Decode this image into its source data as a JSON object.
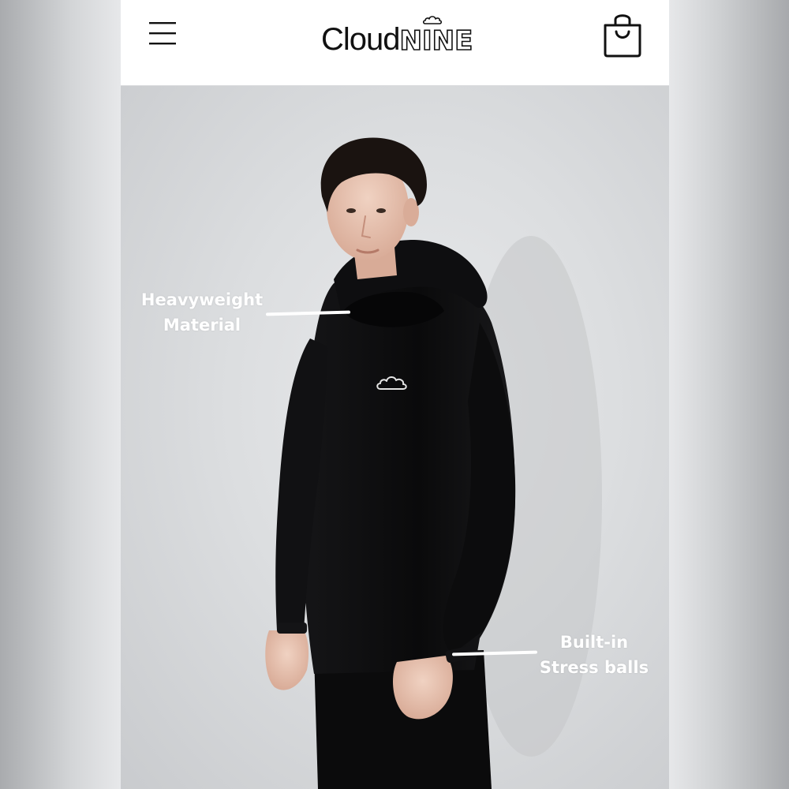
{
  "header": {
    "menu_icon": "hamburger-menu-icon",
    "brand": {
      "name_part1": "Cloud",
      "name_part2": "NINE",
      "icon": "cloud-icon"
    },
    "cart_icon": "shopping-bag-icon"
  },
  "hero": {
    "chest_logo_icon": "cloud-icon",
    "callouts": [
      {
        "line1": "Heavyweight",
        "line2": "Material"
      },
      {
        "line1": "Built-in",
        "line2": "Stress balls"
      }
    ]
  },
  "colors": {
    "header_bg": "#ffffff",
    "hoodie": "#0b0b0c",
    "label_text": "#ffffff",
    "backdrop": "#dcdee0"
  }
}
